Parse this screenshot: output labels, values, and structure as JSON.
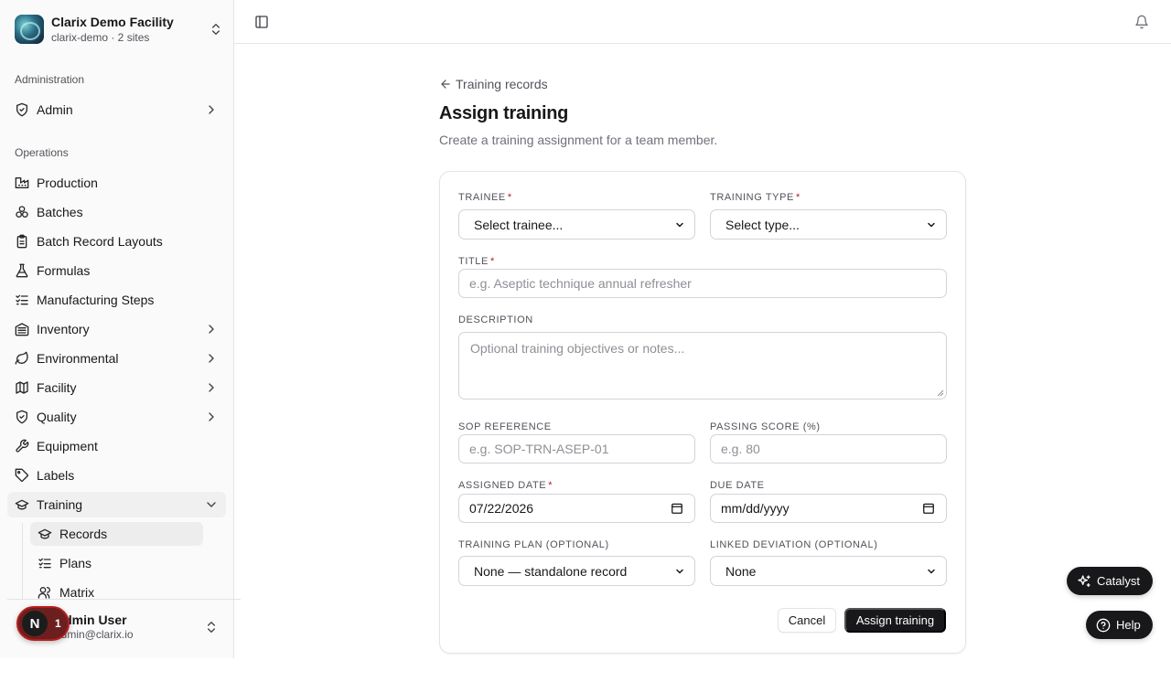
{
  "org": {
    "name": "Clarix Demo Facility",
    "subtitle": "clarix-demo · 2 sites"
  },
  "sidebar": {
    "administration_label": "Administration",
    "admin_label": "Admin",
    "operations_label": "Operations",
    "items": [
      {
        "label": "Production",
        "icon": "factory-icon"
      },
      {
        "label": "Batches",
        "icon": "boxes-icon"
      },
      {
        "label": "Batch Record Layouts",
        "icon": "clipboard-icon"
      },
      {
        "label": "Formulas",
        "icon": "flask-icon"
      },
      {
        "label": "Manufacturing Steps",
        "icon": "list-checks-icon"
      },
      {
        "label": "Inventory",
        "icon": "warehouse-icon"
      },
      {
        "label": "Environmental",
        "icon": "leaf-icon"
      },
      {
        "label": "Facility",
        "icon": "map-icon"
      },
      {
        "label": "Quality",
        "icon": "shield-check-icon"
      },
      {
        "label": "Equipment",
        "icon": "wrench-icon"
      },
      {
        "label": "Labels",
        "icon": "tag-icon"
      },
      {
        "label": "Training",
        "icon": "graduation-cap-icon"
      }
    ],
    "training_sub": [
      {
        "label": "Records",
        "icon": "graduation-cap-icon"
      },
      {
        "label": "Plans",
        "icon": "list-checks-icon"
      },
      {
        "label": "Matrix",
        "icon": "users-icon"
      }
    ]
  },
  "user": {
    "name": "Admin User",
    "email": "admin@clarix.io",
    "badge_letter": "N",
    "badge_count": "1"
  },
  "main": {
    "back_label": "Training records",
    "title": "Assign training",
    "subtitle": "Create a training assignment for a team member."
  },
  "form": {
    "trainee_label": "TRAINEE",
    "trainee_value": "Select trainee...",
    "type_label": "TRAINING TYPE",
    "type_value": "Select type...",
    "title_label": "TITLE",
    "title_placeholder": "e.g. Aseptic technique annual refresher",
    "description_label": "DESCRIPTION",
    "description_placeholder": "Optional training objectives or notes...",
    "sop_label": "SOP REFERENCE",
    "sop_placeholder": "e.g. SOP-TRN-ASEP-01",
    "passing_label": "PASSING SCORE (%)",
    "passing_placeholder": "e.g. 80",
    "assigned_label": "ASSIGNED DATE",
    "assigned_value": "07/22/2026",
    "due_label": "DUE DATE",
    "due_value": "mm/dd/yyyy",
    "plan_label": "TRAINING PLAN (OPTIONAL)",
    "plan_value": "None — standalone record",
    "deviation_label": "LINKED DEVIATION (OPTIONAL)",
    "deviation_value": "None",
    "required_mark": "*",
    "cancel_label": "Cancel",
    "submit_label": "Assign training"
  },
  "floating": {
    "catalyst_label": "Catalyst",
    "help_label": "Help"
  }
}
